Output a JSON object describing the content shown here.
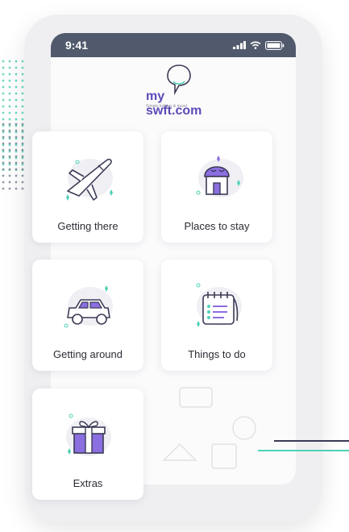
{
  "status_bar": {
    "time": "9:41"
  },
  "logo": {
    "brand": "my swft.com",
    "tagline": "Simple holiday & travel"
  },
  "cards": [
    {
      "label": "Getting there",
      "icon": "airplane-icon"
    },
    {
      "label": "Places to stay",
      "icon": "house-icon"
    },
    {
      "label": "Getting around",
      "icon": "car-icon"
    },
    {
      "label": "Things to do",
      "icon": "calendar-icon"
    },
    {
      "label": "Extras",
      "icon": "gift-icon"
    }
  ],
  "colors": {
    "accent": "#7b5cd6",
    "teal": "#4fd1b5",
    "navy": "#3b4a63",
    "status": "#515a6c"
  }
}
